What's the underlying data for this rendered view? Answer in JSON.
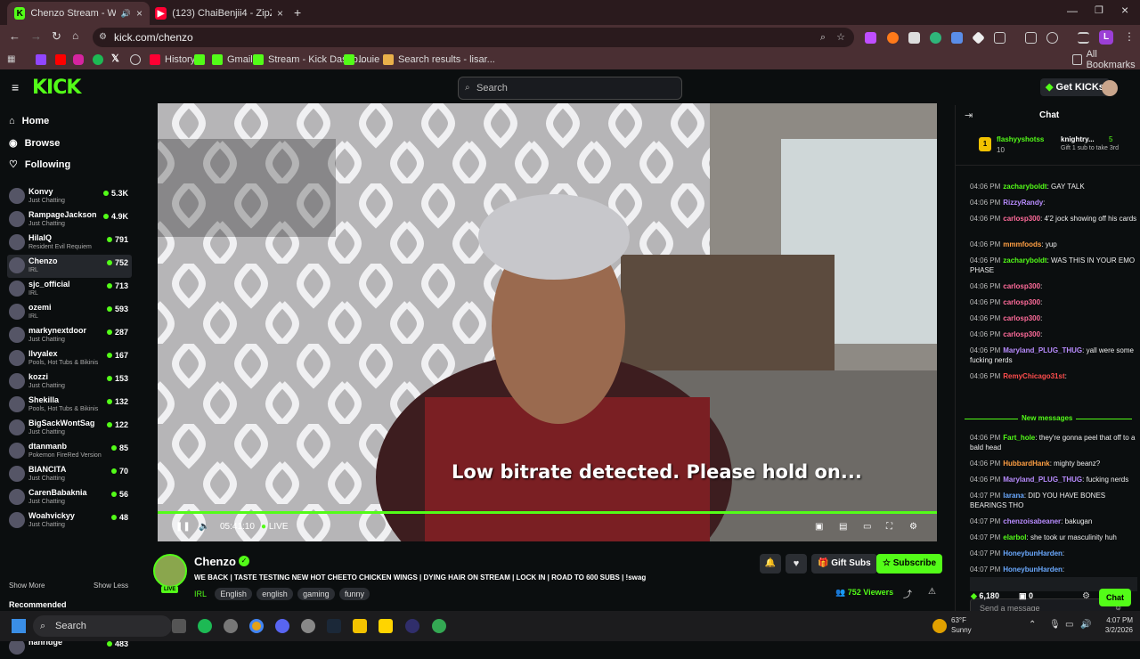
{
  "browser": {
    "tabs": [
      {
        "label": "Chenzo Stream - Watch Liv",
        "active": true
      },
      {
        "label": "(123) ChaiBenjii4 - ZipZip [Offic",
        "active": false
      }
    ],
    "url": "kick.com/chenzo",
    "bookmarks": [
      "History",
      "Gmail",
      "Stream - Kick Dashb...",
      "louie",
      "Search results - lisar..."
    ],
    "all_bookmarks": "All Bookmarks",
    "profile_initial": "L"
  },
  "site": {
    "logo": "KICK",
    "search_placeholder": "Search",
    "get_kicks": "Get KICKs"
  },
  "sidebar": {
    "nav": [
      {
        "label": "Home",
        "icon": "home-icon"
      },
      {
        "label": "Browse",
        "icon": "compass-icon"
      },
      {
        "label": "Following",
        "icon": "heart-icon"
      }
    ],
    "channels": [
      {
        "name": "Konvy",
        "category": "Just Chatting",
        "viewers": "5.3K"
      },
      {
        "name": "RampageJackson",
        "category": "Just Chatting",
        "viewers": "4.9K"
      },
      {
        "name": "HilalQ",
        "category": "Resident Evil Requiem",
        "viewers": "791"
      },
      {
        "name": "Chenzo",
        "category": "IRL",
        "viewers": "752"
      },
      {
        "name": "sjc_official",
        "category": "IRL",
        "viewers": "713"
      },
      {
        "name": "ozemi",
        "category": "IRL",
        "viewers": "593"
      },
      {
        "name": "markynextdoor",
        "category": "Just Chatting",
        "viewers": "287"
      },
      {
        "name": "llvyalex",
        "category": "Pools, Hot Tubs & Bikinis",
        "viewers": "167"
      },
      {
        "name": "kozzi",
        "category": "Just Chatting",
        "viewers": "153"
      },
      {
        "name": "Shekilla",
        "category": "Pools, Hot Tubs & Bikinis",
        "viewers": "132"
      },
      {
        "name": "BigSackWontSag",
        "category": "Just Chatting",
        "viewers": "122"
      },
      {
        "name": "dtanmanb",
        "category": "Pokemon FireRed Version",
        "viewers": "85"
      },
      {
        "name": "BIANCITA",
        "category": "Just Chatting",
        "viewers": "70"
      },
      {
        "name": "CarenBabaknia",
        "category": "Just Chatting",
        "viewers": "56"
      },
      {
        "name": "Woahvickyy",
        "category": "Just Chatting",
        "viewers": "48"
      }
    ],
    "show_more": "Show More",
    "show_less": "Show Less",
    "recommended_title": "Recommended",
    "recommended": [
      {
        "name": "foodiebeautykick",
        "category": "IRL",
        "viewers": "370"
      },
      {
        "name": "hanridge",
        "category": "",
        "viewers": "483"
      }
    ]
  },
  "video": {
    "overlay": "Low bitrate detected. Please hold on...",
    "time": "05:41:10",
    "live": "LIVE"
  },
  "stream": {
    "streamer": "Chenzo",
    "live_badge": "LIVE",
    "title": "WE BACK | TASTE TESTING NEW HOT CHEETO CHICKEN WINGS | DYING HAIR ON STREAM | LOCK IN | ROAD TO 600 SUBS | !swag",
    "category": "IRL",
    "tags": [
      "English",
      "english",
      "gaming",
      "funny"
    ],
    "gift_subs": "Gift Subs",
    "subscribe": "Subscribe",
    "viewers": "752 Viewers"
  },
  "chat": {
    "title": "Chat",
    "pinned": {
      "rank": "1",
      "user1": "flashyyshotss",
      "user1_count": "10",
      "user2": "knightry...",
      "user2_count": "5",
      "user2_note": "Gift 1 sub to take 3rd"
    },
    "messages": [
      {
        "time": "04:06 PM",
        "user": "zacharyboldt",
        "color": "#53fc18",
        "text": "GAY TALK"
      },
      {
        "time": "04:06 PM",
        "user": "RizzyRandy",
        "color": "#b98cff",
        "text": ""
      },
      {
        "time": "04:06 PM",
        "user": "carlosp300",
        "color": "#ff6b9a",
        "text": "4'2 jock showing off his cards"
      },
      {
        "time": "04:06 PM",
        "user": "mmmfoods",
        "color": "#ff9f43",
        "text": "yup"
      },
      {
        "time": "04:06 PM",
        "user": "zacharyboldt",
        "color": "#53fc18",
        "text": "WAS THIS IN YOUR EMO PHASE"
      },
      {
        "time": "04:06 PM",
        "user": "carlosp300",
        "color": "#ff6b9a",
        "text": ""
      },
      {
        "time": "04:06 PM",
        "user": "carlosp300",
        "color": "#ff6b9a",
        "text": ""
      },
      {
        "time": "04:06 PM",
        "user": "carlosp300",
        "color": "#ff6b9a",
        "text": ""
      },
      {
        "time": "04:06 PM",
        "user": "carlosp300",
        "color": "#ff6b9a",
        "text": ""
      },
      {
        "time": "04:06 PM",
        "user": "Maryland_PLUG_THUG",
        "color": "#b98cff",
        "text": "yall were some fucking nerds"
      },
      {
        "time": "04:06 PM",
        "user": "RemyChicago31st",
        "color": "#ff4d4d",
        "text": ""
      }
    ],
    "new_messages": "New messages",
    "new": [
      {
        "time": "04:06 PM",
        "user": "Fart_hole",
        "color": "#53fc18",
        "text": "they're gonna peel that off to a bald head"
      },
      {
        "time": "04:06 PM",
        "user": "HubbardHank",
        "color": "#ff9f43",
        "text": "mighty beanz?"
      },
      {
        "time": "04:06 PM",
        "user": "Maryland_PLUG_THUG",
        "color": "#b98cff",
        "text": "fucking nerds"
      },
      {
        "time": "04:07 PM",
        "user": "larana",
        "color": "#6aa9ff",
        "text": "DID YOU HAVE BONES BEARINGS THO"
      },
      {
        "time": "04:07 PM",
        "user": "chenzoisabeaner",
        "color": "#b98cff",
        "text": "bakugan"
      },
      {
        "time": "04:07 PM",
        "user": "elarbol",
        "color": "#53fc18",
        "text": "she took ur masculinity huh"
      },
      {
        "time": "04:07 PM",
        "user": "HoneybunHarden",
        "color": "#6aa9ff",
        "text": ""
      },
      {
        "time": "04:07 PM",
        "user": "HoneybunHarden",
        "color": "#6aa9ff",
        "text": ""
      }
    ],
    "input_placeholder": "Send a message",
    "kicks": "6,180",
    "gifts": "0",
    "send": "Chat"
  },
  "taskbar": {
    "search": "Search",
    "weather_temp": "63°F",
    "weather_desc": "Sunny",
    "time": "4:07 PM",
    "date": "3/2/2026"
  },
  "colors": {
    "kick_green": "#53fc18",
    "tab_bg": "#2a1a1d",
    "chrome_bg": "#4a2f33"
  }
}
